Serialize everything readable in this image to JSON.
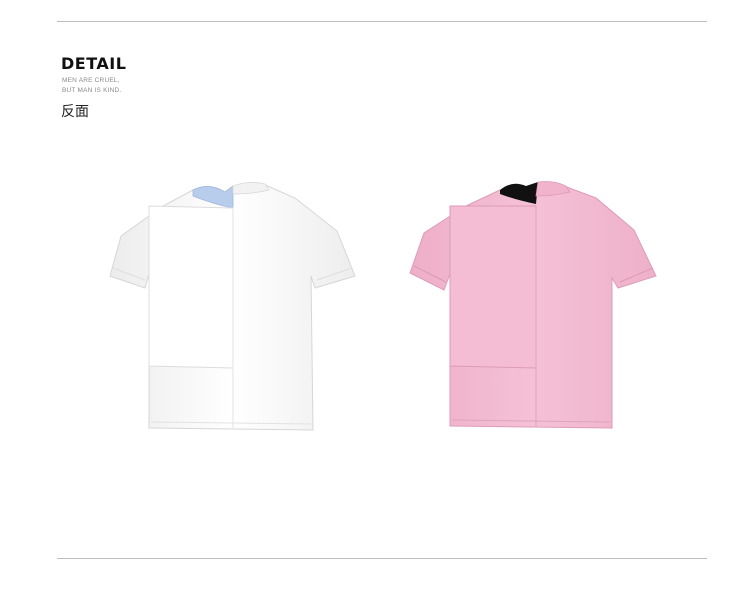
{
  "header": {
    "title": "DETAIL",
    "tagline_1": "MEN ARE CRUEL,",
    "tagline_2": "BUT MAN IS KIND.",
    "subtitle": "反面"
  },
  "products": [
    {
      "name": "white-tshirt-back",
      "body_color": "#f7f7f7",
      "collar_color": "#b8ccec"
    },
    {
      "name": "pink-tshirt-back",
      "body_color": "#f2b8cf",
      "collar_color": "#111111"
    }
  ]
}
